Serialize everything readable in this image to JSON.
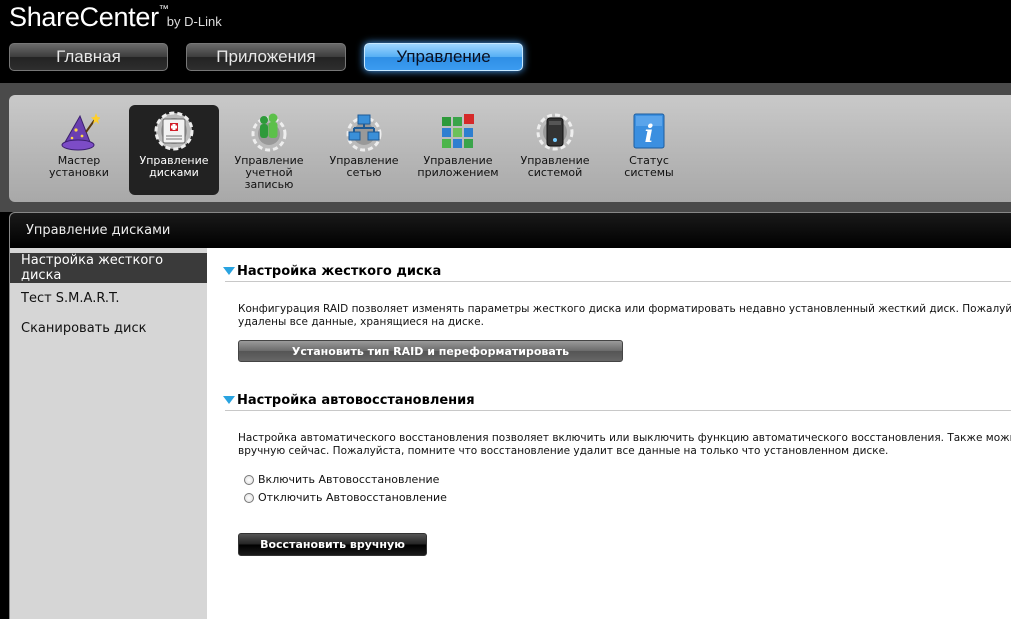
{
  "brand": {
    "name": "ShareCenter",
    "tm": "™",
    "by": "by D-Link"
  },
  "nav": [
    {
      "label": "Главная"
    },
    {
      "label": "Приложения"
    },
    {
      "label": "Управление"
    }
  ],
  "toolbar": [
    {
      "label": "Мастер установки",
      "icon": "wizard-icon"
    },
    {
      "label": "Управление дисками",
      "icon": "disk-management-icon"
    },
    {
      "label": "Управление учетной записью",
      "icon": "account-management-icon"
    },
    {
      "label": "Управление сетью",
      "icon": "network-management-icon"
    },
    {
      "label": "Управление приложением",
      "icon": "application-management-icon"
    },
    {
      "label": "Управление системой",
      "icon": "system-management-icon"
    },
    {
      "label": "Статус системы",
      "icon": "info-icon"
    }
  ],
  "panel": {
    "title": "Управление дисками"
  },
  "sidebar": [
    {
      "label": "Настройка жесткого диска"
    },
    {
      "label": "Тест S.M.A.R.T."
    },
    {
      "label": "Сканировать диск"
    }
  ],
  "hdd": {
    "title": "Настройка жесткого диска",
    "desc1": "Конфигурация RAID позволяет изменять параметры жесткого диска или форматировать недавно установленный жесткий диск. Пожалуйста, обратит",
    "desc2": "удалены все данные, хранящиеся на диске.",
    "button": "Установить тип RAID и переформатировать"
  },
  "autorebuild": {
    "title": "Настройка автовосстановления",
    "desc1": "Настройка автоматического восстановления позволяет включить или выключить функцию автоматического восстановления. Также можно выполнит",
    "desc2": "вручную сейчас. Пожалуйста, помните что восстановление удалит все данные на только что установленном диске.",
    "enable": "Включить Автовосстановление",
    "disable": "Отключить Автовосстановление",
    "button": "Восстановить вручную"
  },
  "colors": {
    "accent": "#29a3e0",
    "active_nav": "#3b9bf0"
  }
}
